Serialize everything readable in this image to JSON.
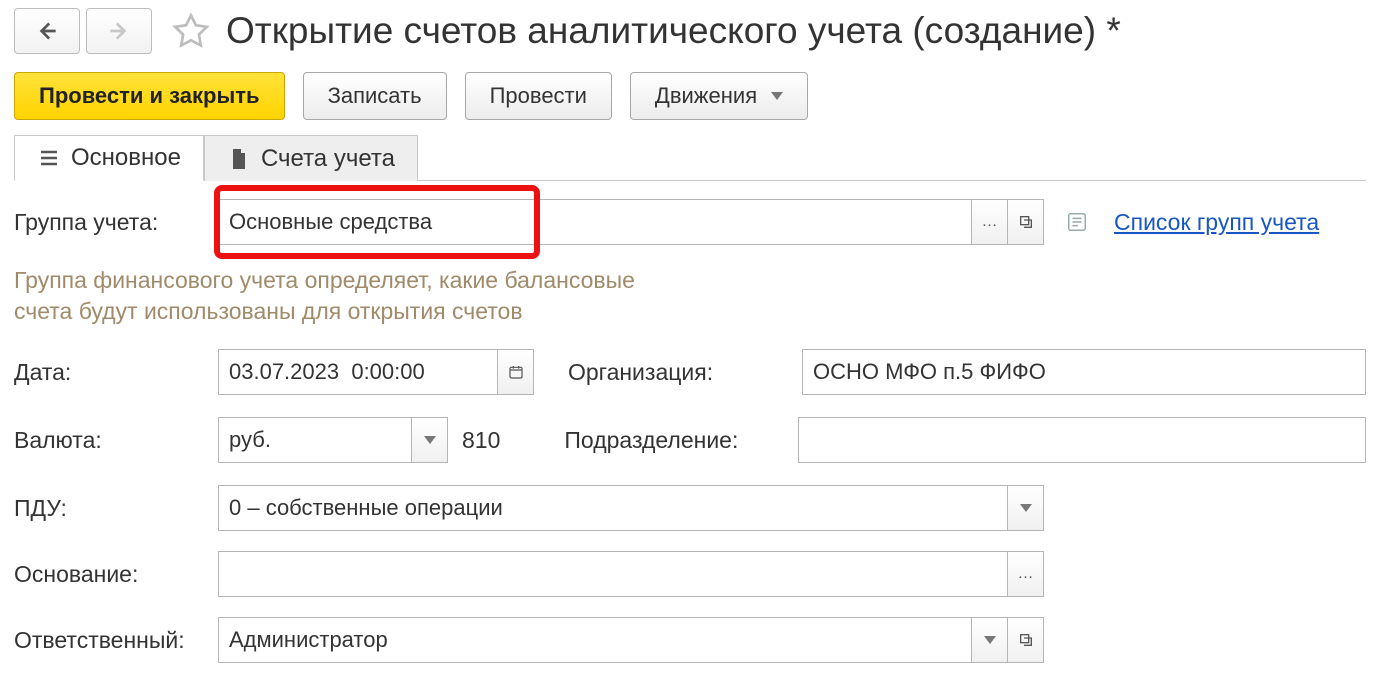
{
  "page": {
    "title": "Открытие счетов аналитического учета (создание) *"
  },
  "toolbar": {
    "post_close": "Провести и закрыть",
    "save": "Записать",
    "post": "Провести",
    "movements": "Движения"
  },
  "tabs": {
    "main": "Основное",
    "accounts": "Счета учета"
  },
  "labels": {
    "account_group": "Группа учета:",
    "date": "Дата:",
    "currency": "Валюта:",
    "pdu": "ПДУ:",
    "basis": "Основание:",
    "responsible": "Ответственный:",
    "organization": "Организация:",
    "department": "Подразделение:"
  },
  "values": {
    "account_group": "Основные средства",
    "date": "03.07.2023  0:00:00",
    "currency": "руб.",
    "currency_code": "810",
    "pdu": "0 – собственные операции",
    "basis": "",
    "responsible": "Администратор",
    "organization": "ОСНО МФО п.5 ФИФО",
    "department": ""
  },
  "helper": {
    "line1": "Группа финансового учета определяет, какие балансовые",
    "line2": "счета будут использованы для открытия счетов"
  },
  "link_groups": "Список групп учета"
}
